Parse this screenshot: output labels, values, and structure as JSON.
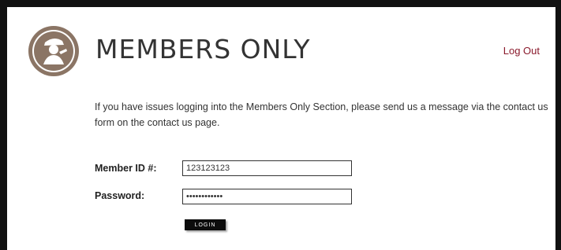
{
  "header": {
    "title": "MEMBERS ONLY",
    "logout_label": "Log Out",
    "logo_icon": "soldier-silhouette-icon"
  },
  "intro": {
    "text": "If you have issues logging into the Members Only Section, please send us a message via the contact us form on the contact us page."
  },
  "form": {
    "member_id_label": "Member ID #:",
    "member_id_value": "123123123",
    "password_label": "Password:",
    "password_value": "************",
    "login_label": "LOGIN"
  },
  "colors": {
    "frame": "#111111",
    "logo": "#8b7565",
    "link": "#8a1a2c"
  }
}
